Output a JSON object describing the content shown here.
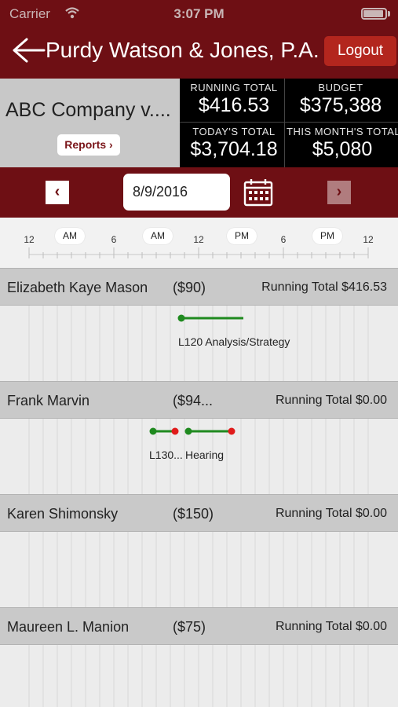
{
  "status_bar": {
    "carrier": "Carrier",
    "time": "3:07 PM"
  },
  "nav": {
    "title": "Purdy Watson & Jones, P.A.",
    "logout_label": "Logout"
  },
  "company": {
    "name": "ABC Company  v....",
    "reports_label": "Reports ›"
  },
  "totals": {
    "running_total_label": "RUNNING TOTAL",
    "running_total_value": "$416.53",
    "budget_label": "BUDGET",
    "budget_value": "$375,388",
    "todays_total_label": "TODAY'S TOTAL",
    "todays_total_value": "$3,704.18",
    "month_total_label": "THIS MONTH'S TOTAL",
    "month_total_value": "$5,080"
  },
  "date_nav": {
    "prev": "‹",
    "next": "›",
    "date": "8/9/2016"
  },
  "timeline": {
    "tick_labels": [
      "12",
      "6",
      "12",
      "6",
      "12"
    ],
    "period_labels": [
      "AM",
      "AM",
      "PM",
      "PM"
    ]
  },
  "rows": [
    {
      "name": "Elizabeth Kaye Mason",
      "rate": "($90)",
      "running_total": "Running Total $416.53",
      "entries": [
        {
          "label": "L120  Analysis/Strategy"
        }
      ]
    },
    {
      "name": "Frank Marvin",
      "rate": "($94...",
      "running_total": "Running Total $0.00",
      "entries": [
        {
          "label": "L130..."
        },
        {
          "label": "Hearing"
        }
      ]
    },
    {
      "name": "Karen Shimonsky",
      "rate": "($150)",
      "running_total": "Running Total $0.00",
      "entries": []
    },
    {
      "name": "Maureen L. Manion",
      "rate": "($75)",
      "running_total": "Running Total $0.00",
      "entries": []
    }
  ],
  "colors": {
    "brand": "#6e0f14",
    "logout": "#b3261e",
    "entry_line": "#1f8a1f",
    "entry_end": "#e01b1b"
  }
}
